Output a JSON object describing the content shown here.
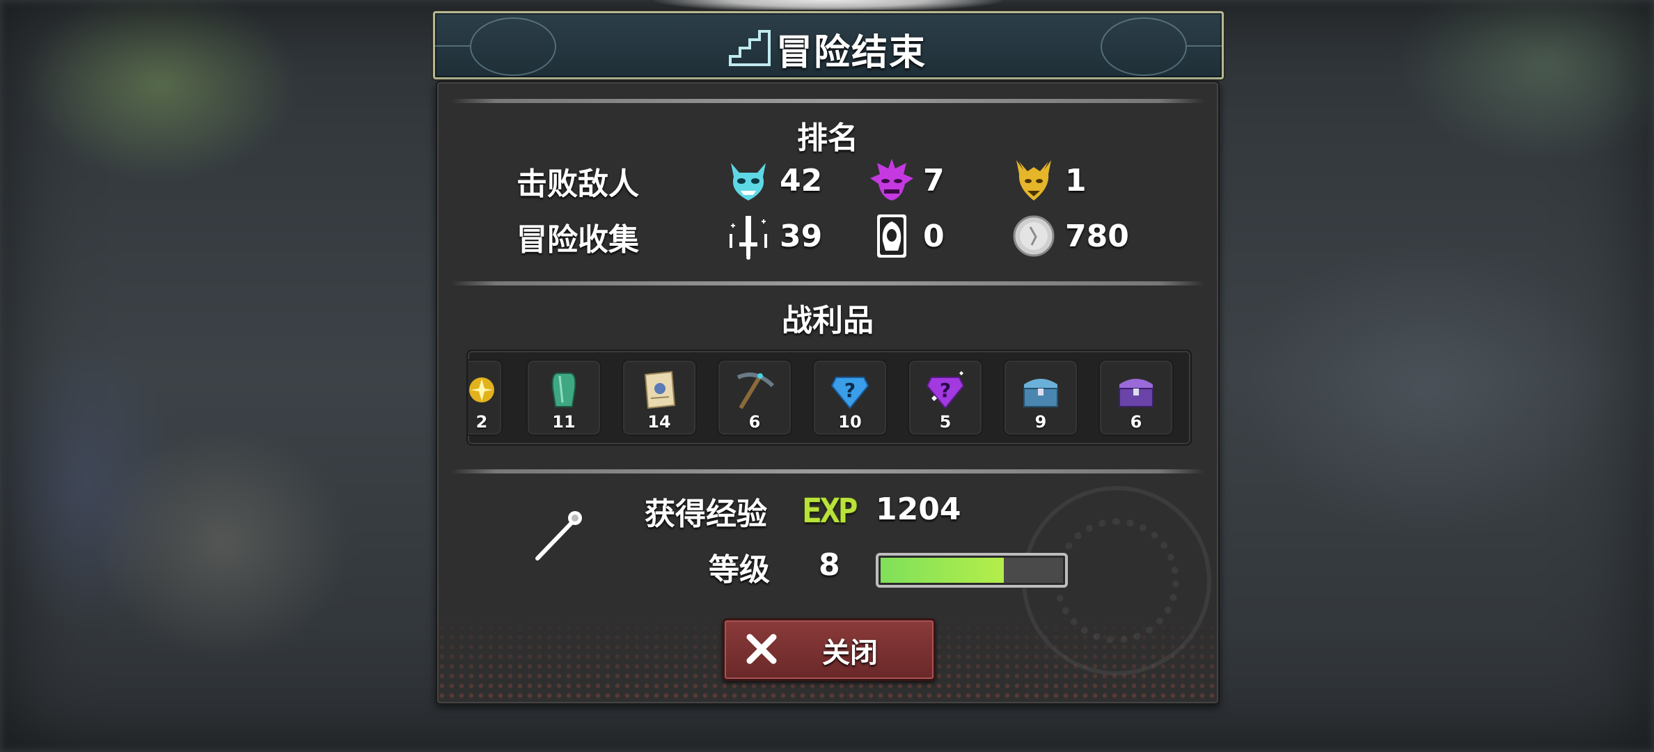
{
  "title": "冒险结束",
  "ranking": {
    "heading": "排名",
    "defeat_label": "击败敌人",
    "collect_label": "冒险收集",
    "defeat": [
      {
        "icon": "cyan-oni-mask-icon",
        "value": "42"
      },
      {
        "icon": "purple-demon-mask-icon",
        "value": "7"
      },
      {
        "icon": "gold-dragon-head-icon",
        "value": "1"
      }
    ],
    "collect": [
      {
        "icon": "sword-sparkle-icon",
        "value": "39"
      },
      {
        "icon": "hooded-figure-card-icon",
        "value": "0"
      },
      {
        "icon": "silver-coin-icon",
        "value": "780"
      }
    ]
  },
  "loot": {
    "heading": "战利品",
    "items": [
      {
        "icon": "gold-emblem-icon",
        "count": "2"
      },
      {
        "icon": "green-crystal-icon",
        "count": "11"
      },
      {
        "icon": "scroll-icon",
        "count": "14"
      },
      {
        "icon": "pickaxe-icon",
        "count": "6"
      },
      {
        "icon": "blue-mystery-gem-icon",
        "count": "10"
      },
      {
        "icon": "purple-mystery-gem-icon",
        "count": "5"
      },
      {
        "icon": "blue-chest-icon",
        "count": "9"
      },
      {
        "icon": "purple-chest-icon",
        "count": "6"
      }
    ]
  },
  "experience": {
    "label": "获得经验",
    "badge": "EXP",
    "value": "1204",
    "level_label": "等级",
    "level": "8",
    "progress_fraction": 0.66
  },
  "close_label": "关闭",
  "colors": {
    "exp_bar": "#8ee452",
    "button": "#7a3030",
    "title_frame": "#b6b894"
  }
}
